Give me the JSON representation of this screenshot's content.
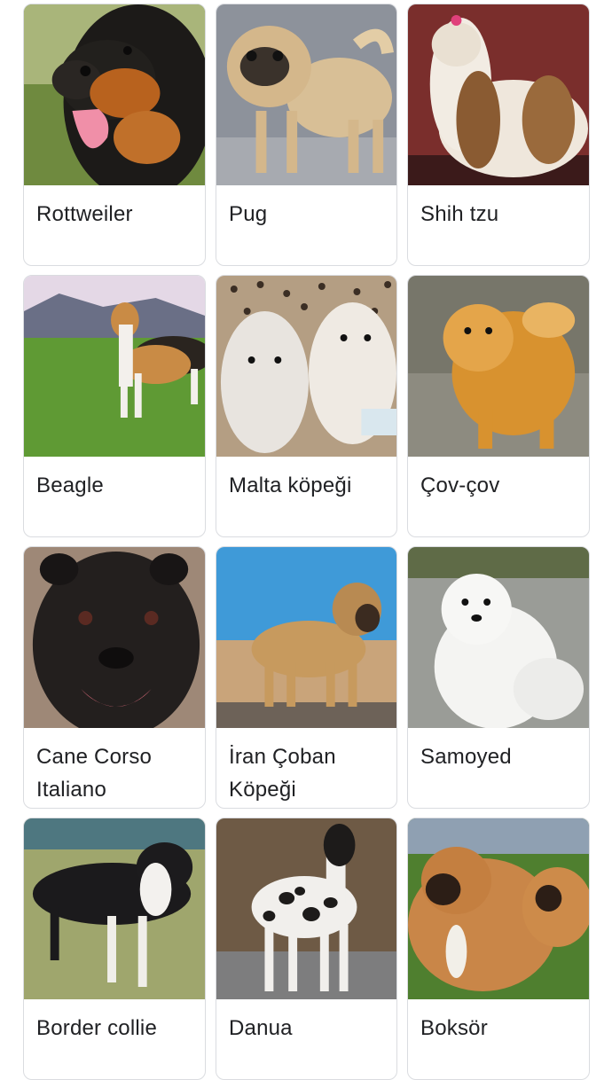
{
  "results": [
    {
      "label": "Rottweiler",
      "image": "rottweiler-photo"
    },
    {
      "label": "Pug",
      "image": "pug-photo"
    },
    {
      "label": "Shih tzu",
      "image": "shih-tzu-photo"
    },
    {
      "label": "Beagle",
      "image": "beagle-photo"
    },
    {
      "label": "Malta köpeği",
      "image": "maltese-photo"
    },
    {
      "label": "Çov-çov",
      "image": "chow-chow-photo"
    },
    {
      "label": "Cane Corso Italiano",
      "image": "cane-corso-photo"
    },
    {
      "label": "İran Çoban Köpeği",
      "image": "iran-shepherd-photo"
    },
    {
      "label": "Samoyed",
      "image": "samoyed-photo"
    },
    {
      "label": "Border collie",
      "image": "border-collie-photo"
    },
    {
      "label": "Danua",
      "image": "great-dane-photo"
    },
    {
      "label": "Boksör",
      "image": "boxer-photo"
    }
  ]
}
